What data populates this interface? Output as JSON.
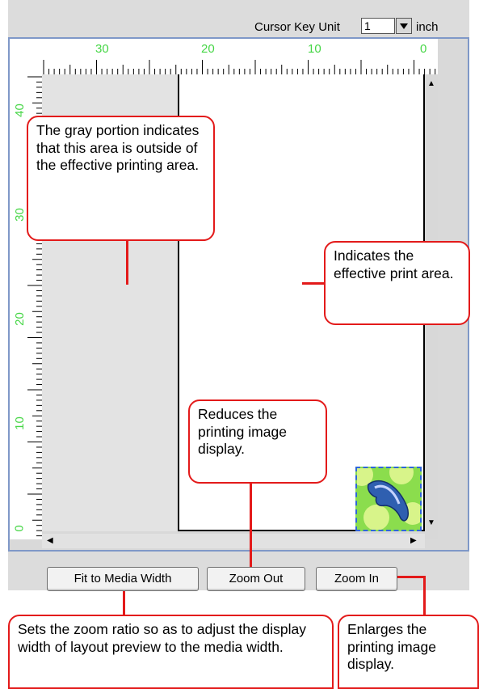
{
  "toolbar": {
    "cursor_key_unit_label": "Cursor Key Unit",
    "cursor_key_unit_value": "1",
    "unit_label": "inch"
  },
  "ruler_top": {
    "labels": [
      "30",
      "20",
      "10",
      "0"
    ]
  },
  "ruler_left": {
    "labels": [
      "40",
      "30",
      "20",
      "10",
      "0"
    ]
  },
  "buttons": {
    "fit_to_media_width": "Fit to Media Width",
    "zoom_out": "Zoom Out",
    "zoom_in": "Zoom In"
  },
  "callouts": {
    "gray_portion": "The gray portion indicates that this area is outside of the effective printing area.",
    "effective_print_area": "Indicates the effective print area.",
    "zoom_out": "Reduces the printing image display.",
    "fit_to_media": "Sets the zoom ratio so as to adjust the display width of layout preview to the media width.",
    "zoom_in": "Enlarges the printing image display."
  },
  "colors": {
    "callout_border": "#e31a1a",
    "ruler_numbers": "#46d646",
    "panel_border": "#7f98c8"
  }
}
